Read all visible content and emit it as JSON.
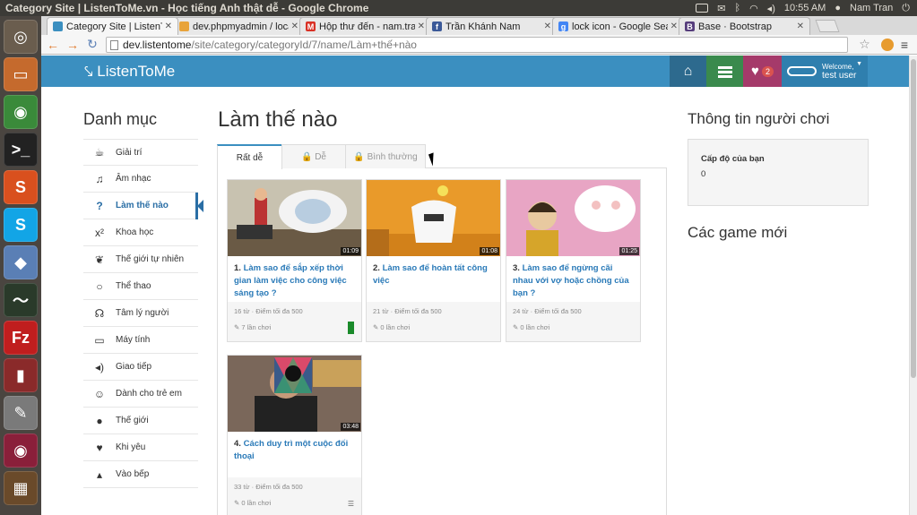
{
  "os": {
    "window_title": "Category Site | ListenToMe.vn - Học tiếng Anh thật dễ - Google Chrome",
    "time": "10:55 AM",
    "user": "Nam Tran"
  },
  "browser": {
    "tabs": [
      {
        "label": "Category Site | ListenToM",
        "color": "#3b8fc0",
        "active": true
      },
      {
        "label": "dev.phpmyadmin / localho",
        "color": "#e8a33a",
        "active": false
      },
      {
        "label": "Hộp thư đến - nam.trankh",
        "color": "#d93025",
        "active": false
      },
      {
        "label": "Trần Khánh Nam",
        "color": "#3b5998",
        "active": false
      },
      {
        "label": "lock icon - Google Search",
        "color": "#4285f4",
        "active": false
      },
      {
        "label": "Base · Bootstrap",
        "color": "#563d7c",
        "active": false
      }
    ],
    "url_host": "dev.listentome",
    "url_path": "/site/category/categoryId/7/name/Làm+thế+nào"
  },
  "navbar": {
    "brand": "ListenToMe",
    "heart_badge": "2",
    "welcome": "Welcome,",
    "username": "test user"
  },
  "sidebar": {
    "heading": "Danh mục",
    "items": [
      {
        "label": "Giải trí",
        "icon": "☕"
      },
      {
        "label": "Âm nhạc",
        "icon": "♫"
      },
      {
        "label": "Làm thế nào",
        "icon": "?"
      },
      {
        "label": "Khoa học",
        "icon": "x²"
      },
      {
        "label": "Thế giới tự nhiên",
        "icon": "❦"
      },
      {
        "label": "Thể thao",
        "icon": "○"
      },
      {
        "label": "Tâm lý người",
        "icon": "☊"
      },
      {
        "label": "Máy tính",
        "icon": "▭"
      },
      {
        "label": "Giao tiếp",
        "icon": "◂)"
      },
      {
        "label": "Dành cho trẻ em",
        "icon": "☺"
      },
      {
        "label": "Thế giới",
        "icon": "●"
      },
      {
        "label": "Khi yêu",
        "icon": "♥"
      },
      {
        "label": "Vào bếp",
        "icon": "▴"
      }
    ]
  },
  "main": {
    "heading": "Làm thế nào",
    "tabs": [
      {
        "label": "Rất dễ"
      },
      {
        "label": "🔒 Dễ"
      },
      {
        "label": "🔒 Bình thường"
      }
    ],
    "cards": [
      {
        "num": "1.",
        "title": "Làm sao để sắp xếp thời gian làm việc cho công việc sáng tạo ?",
        "duration": "01:09",
        "meta": "16 từ · Điểm tối đa 500",
        "plays": "7 lần chơi",
        "thumb_color": "#c8c2b0"
      },
      {
        "num": "2.",
        "title": "Làm sao để hoàn tất công việc",
        "duration": "01:08",
        "meta": "21 từ · Điểm tối đa 500",
        "plays": "0 lần chơi",
        "thumb_color": "#e99a2a"
      },
      {
        "num": "3.",
        "title": "Làm sao để ngừng cãi nhau với vợ hoặc chồng của bạn ?",
        "duration": "01:25",
        "meta": "24 từ · Điểm tối đa 500",
        "plays": "0 lần chơi",
        "thumb_color": "#e8a5c4"
      },
      {
        "num": "4.",
        "title": "Cách duy trì một cuộc đối thoại",
        "duration": "03:48",
        "meta": "33 từ · Điểm tối đa 500",
        "plays": "0 lần chơi",
        "thumb_color": "#6b5a50"
      }
    ]
  },
  "right": {
    "heading": "Thông tin người chơi",
    "level_label": "Cấp độ của bạn",
    "level_value": "0",
    "new_games": "Các game mới"
  }
}
